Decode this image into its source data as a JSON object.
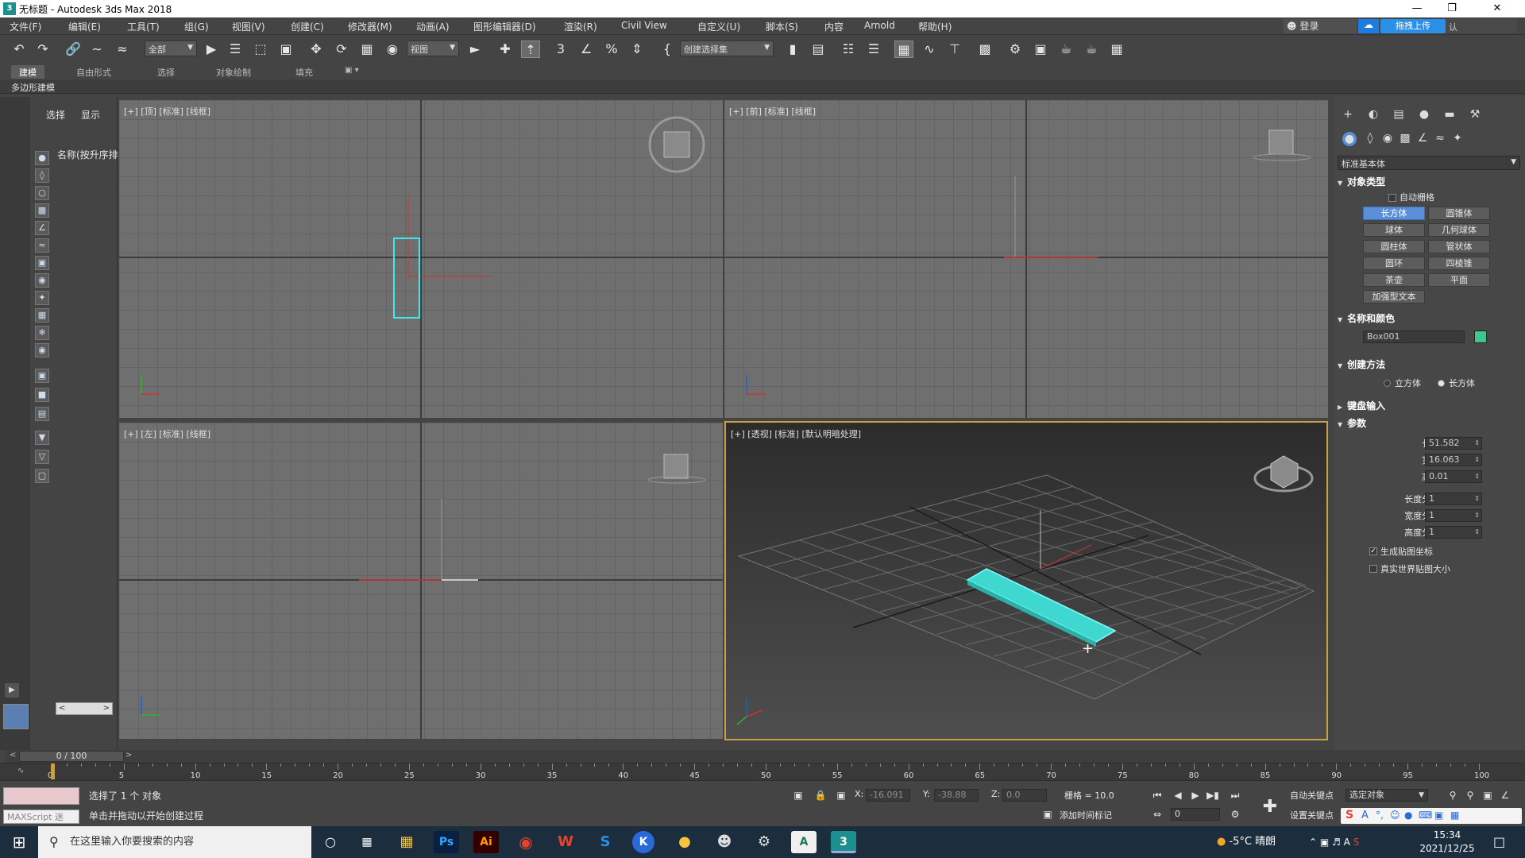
{
  "window": {
    "title": "无标题 - Autodesk 3ds Max 2018",
    "icon_name": "3dsmax-app-icon"
  },
  "menu": {
    "items": [
      "文件(F)",
      "编辑(E)",
      "工具(T)",
      "组(G)",
      "视图(V)",
      "创建(C)",
      "修改器(M)",
      "动画(A)",
      "图形编辑器(D)",
      "渲染(R)",
      "Civil View",
      "自定义(U)",
      "脚本(S)",
      "内容",
      "Arnold",
      "帮助(H)"
    ],
    "login_label": "登录",
    "upload_label": "拖拽上传",
    "upload_tail": "认"
  },
  "toolbar": {
    "selection_filter": "全部",
    "ref_coord": "视图",
    "named_selection": "创建选择集"
  },
  "ribbon": {
    "tabs": [
      "建模",
      "自由形式",
      "选择",
      "对象绘制",
      "填充"
    ],
    "active_tab": "建模",
    "sub_label": "多边形建模"
  },
  "explorer": {
    "tabs": [
      "选择",
      "显示"
    ],
    "header": "名称(按升序排"
  },
  "viewports": {
    "top": {
      "label": "[+] [顶] [标准] [线框]"
    },
    "front": {
      "label": "[+] [前] [标准] [线框]"
    },
    "left": {
      "label": "[+] [左] [标准] [线框]"
    },
    "perspective": {
      "label": "[+] [透视] [标准] [默认明暗处理]"
    }
  },
  "command_panel": {
    "category": "标准基本体",
    "object_type_title": "对象类型",
    "auto_grid_label": "自动栅格",
    "primitives": [
      "长方体",
      "圆锥体",
      "球体",
      "几何球体",
      "圆柱体",
      "管状体",
      "圆环",
      "四棱锥",
      "茶壶",
      "平面",
      "加强型文本"
    ],
    "selected_primitive": "长方体",
    "name_color_title": "名称和颜色",
    "object_name": "Box001",
    "object_color": "#3ec68c",
    "creation_method_title": "创建方法",
    "creation_methods": [
      "立方体",
      "长方体"
    ],
    "creation_method_selected": "长方体",
    "keyboard_entry_title": "键盘输入",
    "params_title": "参数",
    "params": [
      {
        "label": "长度:",
        "value": "51.582"
      },
      {
        "label": "宽度:",
        "value": "16.063"
      },
      {
        "label": "高度:",
        "value": "0.01"
      },
      {
        "label": "长度分段:",
        "value": "1"
      },
      {
        "label": "宽度分段:",
        "value": "1"
      },
      {
        "label": "高度分段:",
        "value": "1"
      }
    ],
    "gen_mapping_label": "生成贴图坐标",
    "gen_mapping_checked": true,
    "real_world_label": "真实世界贴图大小",
    "real_world_checked": false
  },
  "timeline": {
    "frame_display": "0 / 100",
    "current_frame": 0,
    "total_frames": 100,
    "tick_labels": [
      "0",
      "5",
      "10",
      "15",
      "20",
      "25",
      "30",
      "35",
      "40",
      "45",
      "50",
      "55",
      "60",
      "65",
      "70",
      "75",
      "80",
      "85",
      "90",
      "95",
      "100"
    ]
  },
  "status": {
    "maxscript_label": "MAXScript 迷",
    "selection_info": "选择了 1 个 对象",
    "prompt": "单击并拖动以开始创建过程",
    "x_label": "X:",
    "x_value": "-16.091",
    "y_label": "Y:",
    "y_value": "-38.88",
    "z_label": "Z:",
    "z_value": "0.0",
    "grid_label": "栅格 = 10.0",
    "add_time_tag": "添加时间标记",
    "frame_field": "0",
    "auto_key": "自动关键点",
    "set_key": "设置关键点",
    "key_filter": "选定对象"
  },
  "taskbar": {
    "search_placeholder": "在这里输入你要搜索的内容",
    "apps": [
      "file-explorer",
      "photoshop",
      "illustrator",
      "chrome",
      "wps",
      "sogou",
      "kugou",
      "qq-browser",
      "qq",
      "wechat-tool",
      "autocad",
      "3dsmax"
    ],
    "weather": "-5°C 晴朗",
    "time": "15:34",
    "date": "2021/12/25"
  }
}
